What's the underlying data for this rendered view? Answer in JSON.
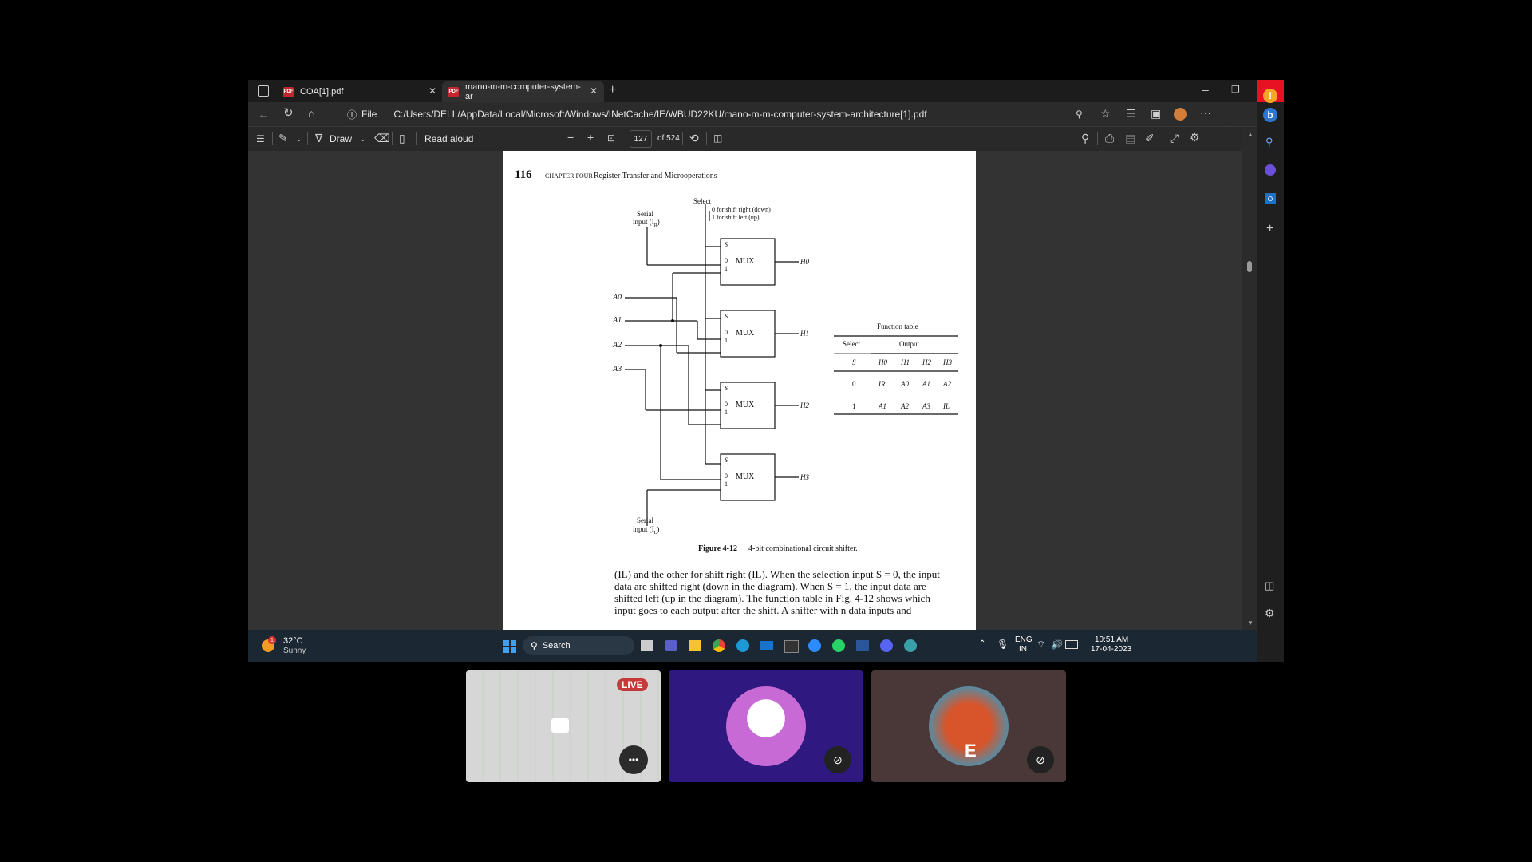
{
  "browser": {
    "tabs": [
      {
        "title": "COA[1].pdf",
        "icon": "pdf-icon"
      },
      {
        "title": "mano-m-m-computer-system-ar",
        "icon": "pdf-icon"
      }
    ],
    "address_prefix": "File",
    "address": "C:/Users/DELL/AppData/Local/Microsoft/Windows/INetCache/IE/WBUD22KU/mano-m-m-computer-system-architecture[1].pdf"
  },
  "pdf_toolbar": {
    "draw_label": "Draw",
    "read_aloud_label": "Read aloud",
    "page_number": "127",
    "page_total": "of 524"
  },
  "page": {
    "page_num": "116",
    "chapter": "CHAPTER FOUR",
    "chapter_title": "Register Transfer and Microoperations",
    "select_label": "Select",
    "select_line1": "0 for shift right (down)",
    "select_line2": "1 for shift left (up)",
    "serial_top": "Serial",
    "serial_top2": "input (I",
    "serial_top_sub": "R",
    "serial_bottom": "Serial",
    "serial_bottom2": "input (I",
    "serial_bottom_sub": "L",
    "inputs": [
      "A0",
      "A1",
      "A2",
      "A3"
    ],
    "mux_label": "MUX",
    "mux_s": "S",
    "mux_0": "0",
    "mux_1": "1",
    "outputs": [
      "H0",
      "H1",
      "H2",
      "H3"
    ],
    "table": {
      "title": "Function table",
      "select_head": "Select",
      "output_head": "Output",
      "cols": [
        "S",
        "H0",
        "H1",
        "H2",
        "H3"
      ],
      "rows": [
        [
          "0",
          "IR",
          "A0",
          "A1",
          "A2"
        ],
        [
          "1",
          "A1",
          "A2",
          "A3",
          "IL"
        ]
      ]
    },
    "figure_label": "Figure 4-12",
    "figure_caption": "4-bit combinational circuit shifter.",
    "body_lines": [
      "(IL) and the other for shift right (IL). When the selection input S = 0, the input",
      "data are shifted right (down in the diagram). When S = 1, the input data are",
      "shifted left (up in the diagram). The function table in Fig. 4-12 shows which",
      "input goes to each output after the shift. A shifter with n data inputs and"
    ]
  },
  "taskbar": {
    "weather_temp": "32°C",
    "weather_desc": "Sunny",
    "weather_badge": "1",
    "search_label": "Search",
    "lang": "ENG",
    "region": "IN",
    "time": "10:51 AM",
    "date": "17-04-2023"
  },
  "call": {
    "live_label": "LIVE",
    "more_label": "•••",
    "tiles": [
      "screen-share",
      "marshmello-avatar",
      "user-e-avatar"
    ],
    "user_initial": "E"
  }
}
